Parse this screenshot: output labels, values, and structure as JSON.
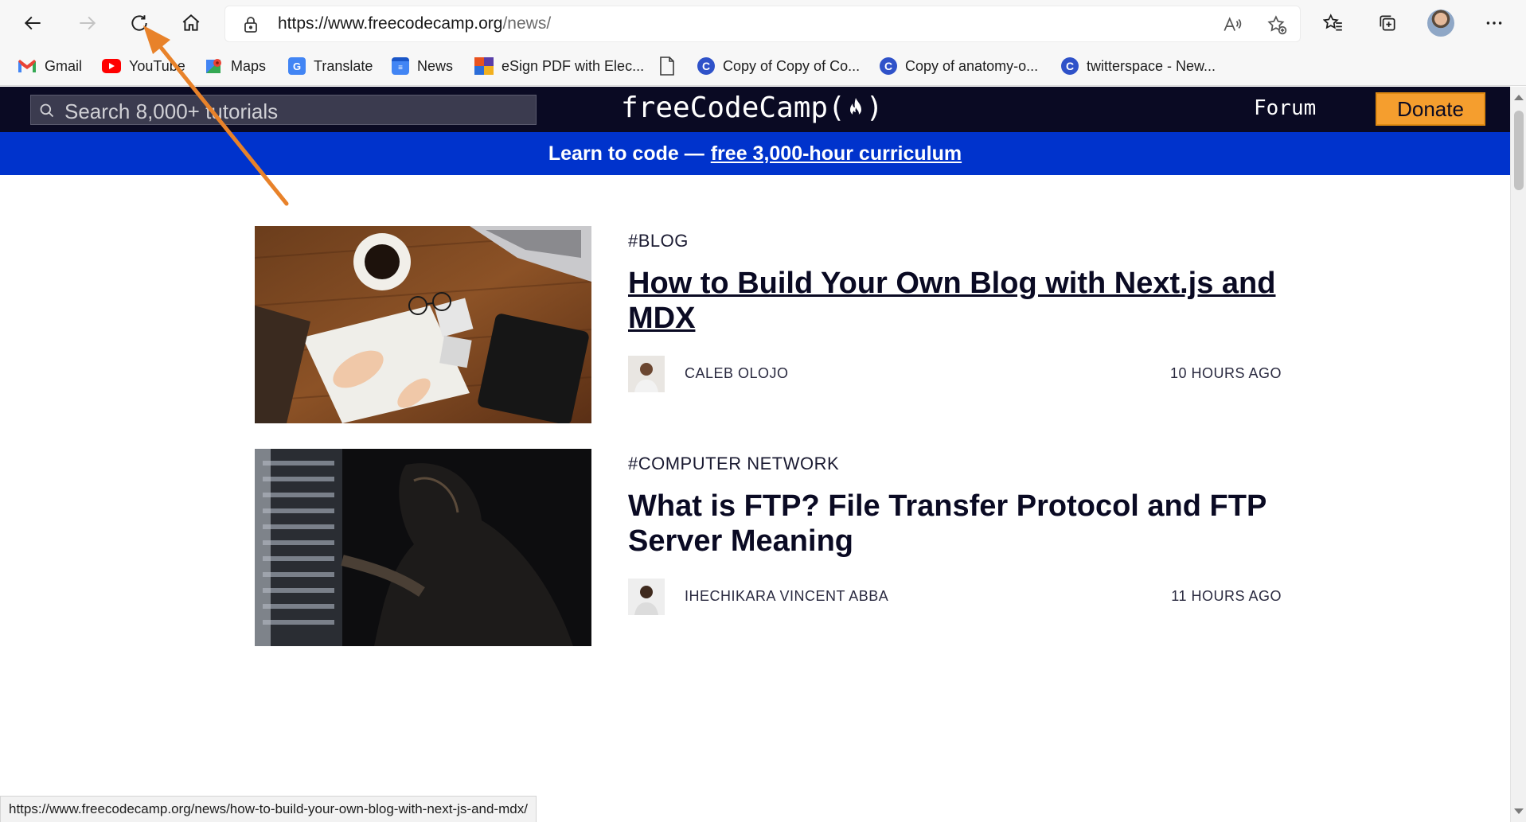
{
  "browser": {
    "url_host": "https://www.freecodecamp.org",
    "url_path": "/news/",
    "status_url": "https://www.freecodecamp.org/news/how-to-build-your-own-blog-with-next-js-and-mdx/"
  },
  "bookmarks": [
    {
      "label": "Gmail",
      "icon": "gmail-icon",
      "color": "#ea4335"
    },
    {
      "label": "YouTube",
      "icon": "youtube-icon",
      "color": "#ff0000"
    },
    {
      "label": "Maps",
      "icon": "maps-icon",
      "color": "#34a853"
    },
    {
      "label": "Translate",
      "icon": "translate-icon",
      "color": "#4285f4"
    },
    {
      "label": "News",
      "icon": "news-icon",
      "color": "#4285f4"
    },
    {
      "label": "eSign PDF with Elec...",
      "icon": "esign-icon",
      "color": "#e8531f"
    },
    {
      "label": "",
      "icon": "page-icon",
      "color": "#5f5f5f"
    },
    {
      "label": "Copy of Copy of Co...",
      "icon": "circle-c-icon",
      "color": "#2f52c9"
    },
    {
      "label": "Copy of anatomy-o...",
      "icon": "circle-c-icon",
      "color": "#2f52c9"
    },
    {
      "label": "twitterspace - New...",
      "icon": "circle-c-icon",
      "color": "#2f52c9"
    }
  ],
  "site": {
    "search_placeholder": "Search 8,000+ tutorials",
    "brand_left": "freeCodeCamp(",
    "brand_right": ")",
    "forum": "Forum",
    "donate": "Donate",
    "banner_text": "Learn to code —",
    "banner_link": "free 3,000-hour curriculum",
    "colors": {
      "nav": "#0a0a23",
      "banner": "#0033cc",
      "donate": "#f59e2e"
    }
  },
  "posts": [
    {
      "tag": "#BLOG",
      "title": "How to Build Your Own Blog with Next.js and MDX",
      "author": "CALEB OLOJO",
      "time": "10 HOURS AGO"
    },
    {
      "tag": "#COMPUTER NETWORK",
      "title": "What is FTP? File Transfer Protocol and FTP Server Meaning",
      "author": "IHECHIKARA VINCENT ABBA",
      "time": "11 HOURS AGO"
    }
  ],
  "annotation": {
    "color": "#e8822a"
  }
}
